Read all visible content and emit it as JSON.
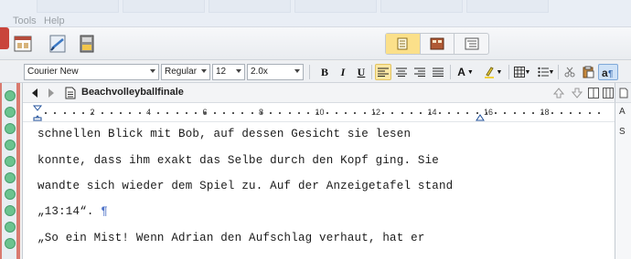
{
  "menu": {
    "tools": "Tools",
    "help": "Help"
  },
  "toolbar": {
    "view_modes": [
      "page-view-icon",
      "corkboard-icon",
      "outline-icon"
    ],
    "active_view_index": 0
  },
  "format": {
    "font_family": "Courier New",
    "font_style": "Regular",
    "font_size": "12",
    "line_spacing": "2.0x",
    "bold": "B",
    "italic": "I",
    "underline": "U",
    "text_color_label": "A"
  },
  "document": {
    "title": "Beachvolleyballfinale",
    "lines": [
      "schnellen Blick mit Bob, auf dessen Gesicht sie lesen",
      "konnte, dass ihm exakt das Selbe durch den Kopf ging. Sie",
      "wandte sich wieder dem Spiel zu. Auf der Anzeigetafel stand",
      "„13:14“. ",
      "„So ein Mist! Wenn Adrian den Aufschlag verhaut, hat er"
    ],
    "pilcrow": "¶"
  },
  "ruler": {
    "numbers": [
      "2",
      "4",
      "6",
      "8",
      "10",
      "12",
      "14",
      "16",
      "18"
    ]
  },
  "right_panel": {
    "tab_s": "S",
    "tab_a": "A"
  },
  "colors": {
    "accent_yellow": "#fbe7a4",
    "gutter_green": "#6bc38f",
    "pilcrow_blue": "#4f73c8"
  }
}
